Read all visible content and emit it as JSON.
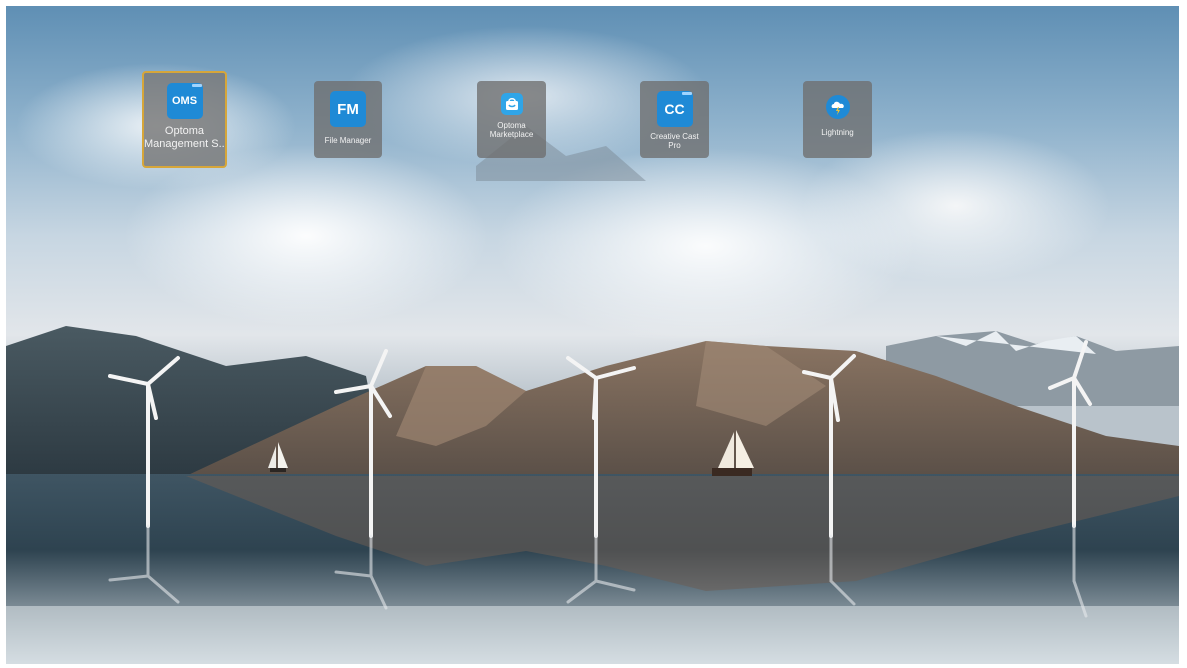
{
  "launcher": {
    "apps": [
      {
        "name": "Optoma Management S...",
        "label_line1": "Optoma",
        "label_line2": "Management S...",
        "icon": "oms-icon",
        "glyph": "OMS",
        "color": "#1f8ad6"
      },
      {
        "name": "File Manager",
        "label_line1": "File Manager",
        "label_line2": "",
        "icon": "file-manager-icon",
        "glyph": "FM",
        "color": "#1f8ad6"
      },
      {
        "name": "Optoma Marketplace",
        "label_line1": "Optoma",
        "label_line2": "Marketplace",
        "icon": "marketplace-bag-icon",
        "glyph": "",
        "color": "#2fa5e8"
      },
      {
        "name": "Creative Cast Pro",
        "label_line1": "Creative Cast",
        "label_line2": "Pro",
        "icon": "creative-cast-icon",
        "glyph": "CC",
        "color": "#1f8ad6"
      },
      {
        "name": "Lightning",
        "label_line1": "Lightning",
        "label_line2": "",
        "icon": "lightning-cloud-icon",
        "glyph": "",
        "color": "#1f8ad6"
      }
    ],
    "focused_index": 0,
    "focus_color": "#d6a63a"
  }
}
